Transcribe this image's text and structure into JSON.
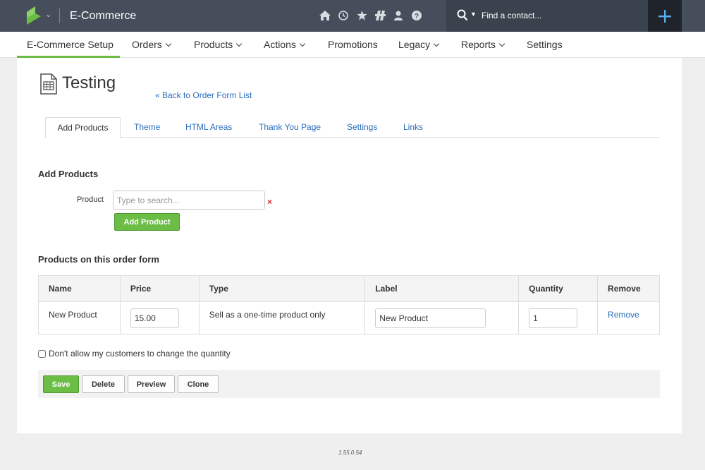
{
  "app": {
    "title": "E-Commerce",
    "brand_color": "#6bbd45"
  },
  "top_icons": [
    "home-icon",
    "clock-icon",
    "star-icon",
    "grid-icon",
    "user-icon",
    "help-icon"
  ],
  "search": {
    "placeholder": "Find a contact..."
  },
  "nav": {
    "items": [
      {
        "label": "E-Commerce Setup",
        "active": true
      },
      {
        "label": "Orders",
        "dropdown": true
      },
      {
        "label": "Products",
        "dropdown": true
      },
      {
        "label": "Actions",
        "dropdown": true
      },
      {
        "label": "Promotions"
      },
      {
        "label": "Legacy",
        "dropdown": true
      },
      {
        "label": "Reports",
        "dropdown": true
      },
      {
        "label": "Settings"
      }
    ]
  },
  "page": {
    "title": "Testing",
    "back_link": "« Back to Order Form List"
  },
  "tabs": [
    {
      "label": "Add Products",
      "active": true
    },
    {
      "label": "Theme"
    },
    {
      "label": "HTML Areas"
    },
    {
      "label": "Thank You Page"
    },
    {
      "label": "Settings"
    },
    {
      "label": "Links"
    }
  ],
  "add_products": {
    "heading": "Add Products",
    "product_label": "Product",
    "product_placeholder": "Type to search...",
    "clear_symbol": "×",
    "add_button": "Add Product"
  },
  "order_form": {
    "heading": "Products on this order form",
    "columns": [
      "Name",
      "Price",
      "Type",
      "Label",
      "Quantity",
      "Remove"
    ],
    "rows": [
      {
        "name": "New Product",
        "price": "15.00",
        "type": "Sell as a one-time product only",
        "label": "New Product",
        "quantity": "1",
        "remove": "Remove"
      }
    ]
  },
  "quantity_checkbox": {
    "label": "Don't allow my customers to change the quantity",
    "checked": false
  },
  "actions": {
    "save": "Save",
    "delete": "Delete",
    "preview": "Preview",
    "clone": "Clone"
  },
  "footer": {
    "version": "1.55.0.54"
  }
}
